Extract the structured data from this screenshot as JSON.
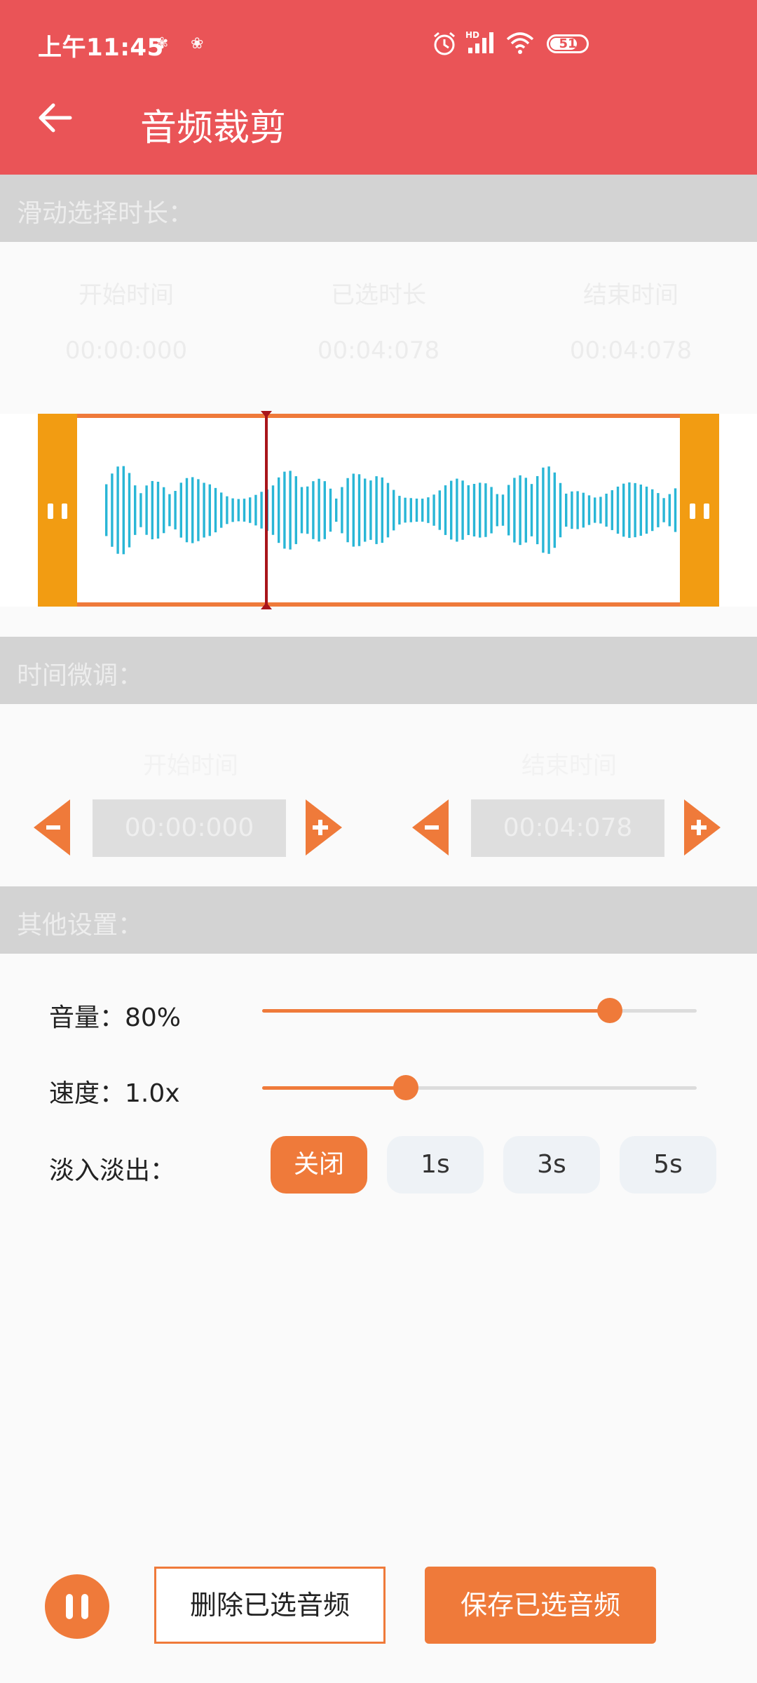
{
  "status_bar": {
    "time": "上午11:45",
    "battery": "51"
  },
  "toolbar": {
    "title": "音频裁剪"
  },
  "sections": {
    "slide_select": "滑动选择时长：",
    "fine_tune": "时间微调：",
    "other_settings": "其他设置："
  },
  "duration_info": {
    "start_label": "开始时间",
    "start_value": "00:00:000",
    "selected_label": "已选时长",
    "selected_value": "00:04:078",
    "end_label": "结束时间",
    "end_value": "00:04:078"
  },
  "fine_tune": {
    "start_label": "开始时间",
    "start_value": "00:00:000",
    "end_label": "结束时间",
    "end_value": "00:04:078"
  },
  "settings": {
    "volume_label": "音量：80%",
    "volume_level": 0.8,
    "speed_label": "速度：1.0x",
    "speed_level": 0.33,
    "fade_label": "淡入淡出：",
    "fade_options": [
      "关闭",
      "1s",
      "3s",
      "5s"
    ],
    "fade_selected": "关闭"
  },
  "actions": {
    "delete_label": "删除已选音频",
    "save_label": "保存已选音频"
  },
  "colors": {
    "header": "#ea5457",
    "accent": "#ef7a3a",
    "handle": "#f29c12",
    "waveform": "#29b6d6",
    "playhead": "#a8151b"
  }
}
